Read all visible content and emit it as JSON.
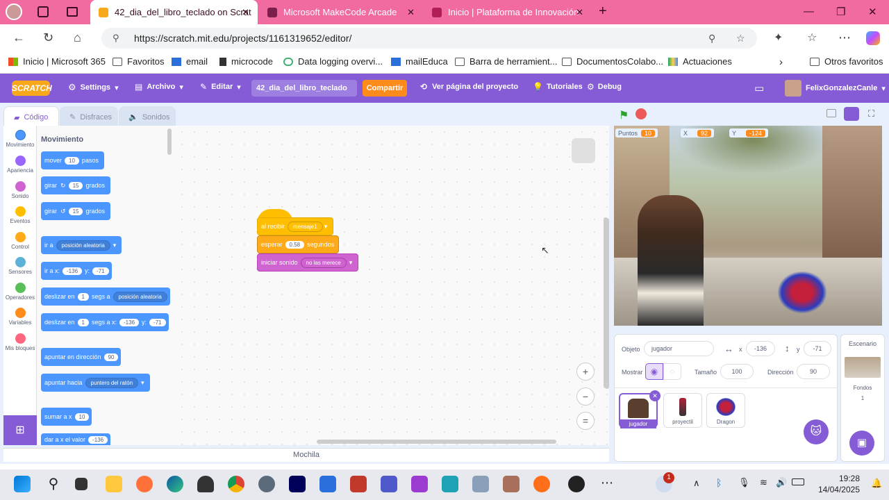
{
  "browser": {
    "tabs": [
      {
        "title": "42_dia_del_libro_teclado on Scrat",
        "active": true
      },
      {
        "title": "Microsoft MakeCode Arcade",
        "active": false
      },
      {
        "title": "Inicio | Plataforma de Innovación",
        "active": false
      }
    ],
    "url": "https://scratch.mit.edu/projects/1161319652/editor/",
    "favorites": [
      "Inicio | Microsoft 365",
      "Favoritos",
      "email",
      "microcode",
      "Data logging overvi...",
      "mailEduca",
      "Barra de herramient...",
      "DocumentosColabo...",
      "Actuaciones",
      "Otros favoritos"
    ]
  },
  "menubar": {
    "logo": "SCRATCH",
    "settings": "Settings",
    "file": "Archivo",
    "edit": "Editar",
    "project_title": "42_dia_del_libro_teclado",
    "share": "Compartir",
    "see_project": "Ver página del proyecto",
    "tutorials": "Tutoriales",
    "debug": "Debug",
    "user": "FelixGonzalezCanle"
  },
  "editor_tabs": {
    "code": "Código",
    "costumes": "Disfraces",
    "sounds": "Sonidos"
  },
  "categories": [
    {
      "label": "Movimiento",
      "color": "#4c97ff"
    },
    {
      "label": "Apariencia",
      "color": "#9966ff"
    },
    {
      "label": "Sonido",
      "color": "#cf63cf"
    },
    {
      "label": "Eventos",
      "color": "#ffbf00"
    },
    {
      "label": "Control",
      "color": "#ffab19"
    },
    {
      "label": "Sensores",
      "color": "#5cb1d6"
    },
    {
      "label": "Operadores",
      "color": "#59c059"
    },
    {
      "label": "Variables",
      "color": "#ff8c1a"
    },
    {
      "label": "Mis bloques",
      "color": "#ff6680"
    }
  ],
  "palette": {
    "heading": "Movimiento",
    "b1": {
      "a": "mover",
      "v": "10",
      "b": "pasos"
    },
    "b2": {
      "a": "girar",
      "v": "15",
      "b": "grados"
    },
    "b3": {
      "a": "girar",
      "v": "15",
      "b": "grados"
    },
    "b4": {
      "a": "ir a",
      "d": "posición aleatoria"
    },
    "b5": {
      "a": "ir a x:",
      "x": "-136",
      "y_label": "y:",
      "y": "-71"
    },
    "b6": {
      "a": "deslizar en",
      "v": "1",
      "b": "segs a",
      "d": "posición aleatoria"
    },
    "b7": {
      "a": "deslizar en",
      "v": "1",
      "b": "segs a x:",
      "x": "-136",
      "y_label": "y:",
      "y": "-71"
    },
    "b8": {
      "a": "apuntar en dirección",
      "v": "90"
    },
    "b9": {
      "a": "apuntar hacia",
      "d": "puntero del ratón"
    },
    "b10": {
      "a": "sumar a x",
      "v": "10"
    },
    "b11": {
      "a": "dar a x el valor",
      "v": "-136"
    }
  },
  "script": {
    "hat": {
      "a": "al recibir",
      "d": "mensaje1"
    },
    "wait": {
      "a": "esperar",
      "v": "0.58",
      "b": "segundos"
    },
    "sound": {
      "a": "iniciar sonido",
      "d": "no las merece"
    }
  },
  "backpack": "Mochila",
  "monitors": [
    {
      "label": "Puntos",
      "value": "10"
    },
    {
      "label": "X",
      "value": "92"
    },
    {
      "label": "Y",
      "value": "-124"
    }
  ],
  "sprite_info": {
    "object_label": "Objeto",
    "name": "jugador",
    "x_label": "x",
    "x": "-136",
    "y_label": "y",
    "y": "-71",
    "show_label": "Mostrar",
    "size_label": "Tamaño",
    "size": "100",
    "direction_label": "Dirección",
    "direction": "90"
  },
  "sprites": [
    "jugador",
    "proyectil",
    "Dragon"
  ],
  "stage_panel": {
    "title": "Escenario",
    "backdrops_label": "Fondos",
    "backdrops_count": "1"
  },
  "taskbar": {
    "time": "19:28",
    "date": "14/04/2025",
    "badge": "1"
  }
}
